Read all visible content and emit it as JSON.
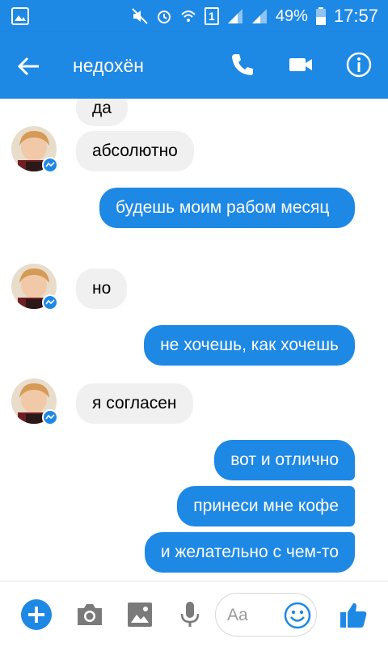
{
  "status_bar": {
    "sim_label": "1",
    "battery_percent": "49%",
    "time": "17:57",
    "icons": [
      "gallery-icon",
      "mute-icon",
      "alarm-icon",
      "wifi-icon",
      "sim-icon",
      "signal-icon",
      "signal-icon",
      "battery-icon"
    ]
  },
  "header": {
    "title": "недохён",
    "icons": [
      "back-arrow-icon",
      "phone-icon",
      "video-camera-icon",
      "info-icon"
    ]
  },
  "messages": [
    {
      "side": "in",
      "text": "да"
    },
    {
      "side": "in",
      "text": "абсолютно"
    },
    {
      "side": "out",
      "text": "будешь моим рабом месяц"
    },
    {
      "side": "in",
      "text": "но"
    },
    {
      "side": "out",
      "text": "не хочешь, как хочешь"
    },
    {
      "side": "in",
      "text": "я согласен"
    },
    {
      "side": "out",
      "text": "вот и отлично"
    },
    {
      "side": "out",
      "text": "принеси мне кофе"
    },
    {
      "side": "out",
      "text": "и желательно с чем-то"
    }
  ],
  "composer": {
    "placeholder": "Aa",
    "icons": [
      "plus-icon",
      "camera-icon",
      "image-icon",
      "microphone-icon",
      "emoji-icon",
      "thumbs-up-icon"
    ]
  },
  "colors": {
    "primary": "#1e88e5",
    "incoming_bubble": "#f1f0f0",
    "outgoing_bubble": "#1e88e5"
  }
}
